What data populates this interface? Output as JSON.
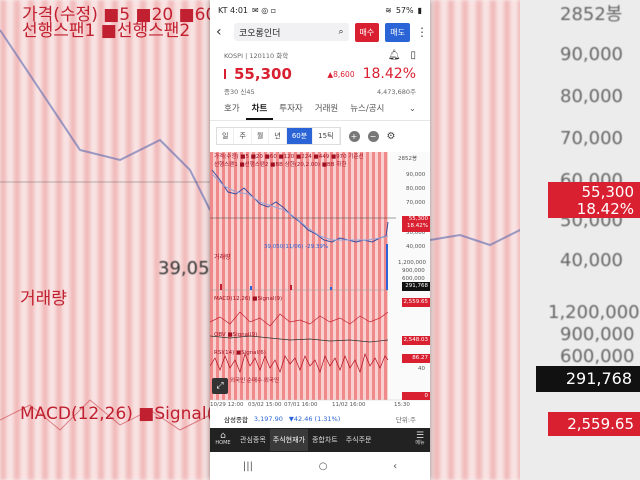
{
  "status_bar": {
    "carrier_time": "KT 4:01",
    "battery": "57%"
  },
  "header": {
    "stock_name": "코오롱인더",
    "buy_label": "매수",
    "sell_label": "매도"
  },
  "market": {
    "exchange": "KOSPI",
    "code": "120110 화학"
  },
  "quote": {
    "price": "55,300",
    "change": "▲8,600",
    "change_pct": "18.42%",
    "margin": "증30",
    "credit": "신45",
    "volume": "4,473,680주"
  },
  "tabs": [
    "호가",
    "차트",
    "투자자",
    "거래원",
    "뉴스/공시"
  ],
  "period": {
    "options": [
      "일",
      "주",
      "월",
      "년",
      "60분",
      "15틱"
    ],
    "selected": "60분"
  },
  "chart_legend": {
    "line1": "가격(수정) ■5 ■20 ■60 ■120 ■224 ■449 ■970 기준선",
    "line2": "선행스팬1 ■선행스팬2 ■BB 상한(20,2.00) ■BB 하한",
    "volume": "거래량",
    "macd": "MACD(12,26) ■Signal(9)",
    "obv": "OBV ■Signal(9)",
    "rsi": "RSI(14) ■Signal(6)",
    "foreign": "외국인 순매수·외국인"
  },
  "chart_axis": {
    "price_ticks": [
      "2852봉",
      "90,000",
      "80,000",
      "70,000",
      "60,000",
      "50,000",
      "40,000"
    ],
    "vol_ticks": [
      "1,200,000",
      "900,000",
      "600,000"
    ],
    "low_marker": "39,050(11/06) -29.39%",
    "x_ticks": [
      "10/29 12:00",
      "03/02 15:00",
      "07/01 16:00",
      "11/02 16:00",
      "15:30"
    ],
    "unit": "단위:주"
  },
  "chart_tags": {
    "price": "55,300",
    "price_pct": "18.42%",
    "volume": "291,768",
    "macd": "2,559.65",
    "obv": "2,548.03",
    "rsi": "86.27",
    "rsi_base": "40",
    "zero": "0"
  },
  "index_bar": {
    "name": "삼성종합",
    "value": "3,197.90",
    "change": "▼42.46 (1.31%)"
  },
  "bottom_nav": {
    "home": "HOME",
    "items": [
      "관심종목",
      "주식현재가",
      "종합차트",
      "주식주문"
    ],
    "menu": "메뉴"
  },
  "background": {
    "left_labels": [
      "가격(수정) ■5 ■20 ■60",
      "선행스팬1 ■선행스팬2",
      "39,050",
      "거래량",
      "MACD(12,26) ■Signal(9)"
    ],
    "right_ticks": [
      "2852봉",
      "90,000",
      "80,000",
      "70,000",
      "60,000",
      "50,000",
      "40,000",
      "1,200,000",
      "900,000",
      "600,000"
    ],
    "right_tags": {
      "price": "55,300",
      "pct": "18.42%",
      "volume": "291,768",
      "macd": "2,559.65"
    }
  },
  "colors": {
    "up": "#d92030",
    "down": "#2a64d6",
    "nav_bg": "#222222"
  }
}
